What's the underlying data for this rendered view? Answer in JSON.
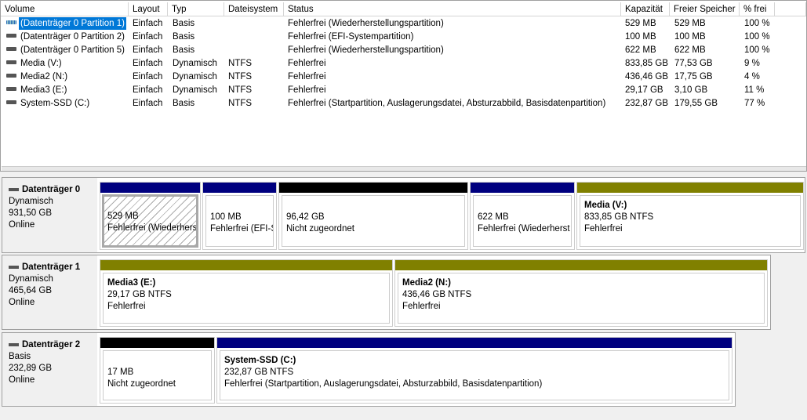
{
  "columns": [
    "Volume",
    "Layout",
    "Typ",
    "Dateisystem",
    "Status",
    "Kapazität",
    "Freier Speicher",
    "% frei"
  ],
  "volumes": [
    [
      "(Datenträger 0 Partition 1)",
      "Einfach",
      "Basis",
      "",
      "Fehlerfrei (Wiederherstellungspartition)",
      "529 MB",
      "529 MB",
      "100 %"
    ],
    [
      "(Datenträger 0 Partition 2)",
      "Einfach",
      "Basis",
      "",
      "Fehlerfrei (EFI-Systempartition)",
      "100 MB",
      "100 MB",
      "100 %"
    ],
    [
      "(Datenträger 0 Partition 5)",
      "Einfach",
      "Basis",
      "",
      "Fehlerfrei (Wiederherstellungspartition)",
      "622 MB",
      "622 MB",
      "100 %"
    ],
    [
      "Media (V:)",
      "Einfach",
      "Dynamisch",
      "NTFS",
      "Fehlerfrei",
      "833,85 GB",
      "77,53 GB",
      "9 %"
    ],
    [
      "Media2 (N:)",
      "Einfach",
      "Dynamisch",
      "NTFS",
      "Fehlerfrei",
      "436,46 GB",
      "17,75 GB",
      "4 %"
    ],
    [
      "Media3 (E:)",
      "Einfach",
      "Dynamisch",
      "NTFS",
      "Fehlerfrei",
      "29,17 GB",
      "3,10 GB",
      "11 %"
    ],
    [
      "System-SSD (C:)",
      "Einfach",
      "Basis",
      "NTFS",
      "Fehlerfrei (Startpartition, Auslagerungsdatei, Absturzabbild, Basisdatenpartition)",
      "232,87 GB",
      "179,55 GB",
      "77 %"
    ]
  ],
  "disks": [
    {
      "name": "Datenträger 0",
      "type": "Dynamisch",
      "size": "931,50 GB",
      "state": "Online",
      "partitions": [
        {
          "title": "",
          "line1": "529 MB",
          "line2": "Fehlerfrei (Wiederhers",
          "color": "#00007f",
          "selected": true
        },
        {
          "title": "",
          "line1": "100 MB",
          "line2": "Fehlerfrei (EFI-S",
          "color": "#00007f"
        },
        {
          "title": "",
          "line1": "96,42 GB",
          "line2": "Nicht zugeordnet",
          "color": "#000000"
        },
        {
          "title": "",
          "line1": "622 MB",
          "line2": "Fehlerfrei (Wiederherst",
          "color": "#00007f"
        },
        {
          "title": "Media  (V:)",
          "line1": "833,85 GB NTFS",
          "line2": "Fehlerfrei",
          "color": "#808000"
        }
      ]
    },
    {
      "name": "Datenträger 1",
      "type": "Dynamisch",
      "size": "465,64 GB",
      "state": "Online",
      "partitions": [
        {
          "title": "Media3  (E:)",
          "line1": "29,17 GB NTFS",
          "line2": "Fehlerfrei",
          "color": "#808000"
        },
        {
          "title": "Media2  (N:)",
          "line1": "436,46 GB NTFS",
          "line2": "Fehlerfrei",
          "color": "#808000"
        }
      ]
    },
    {
      "name": "Datenträger 2",
      "type": "Basis",
      "size": "232,89 GB",
      "state": "Online",
      "partitions": [
        {
          "title": "",
          "line1": "17 MB",
          "line2": "Nicht zugeordnet",
          "color": "#000000"
        },
        {
          "title": "System-SSD  (C:)",
          "line1": "232,87 GB NTFS",
          "line2": "Fehlerfrei (Startpartition, Auslagerungsdatei, Absturzabbild, Basisdatenpartition)",
          "color": "#00007f"
        }
      ]
    }
  ]
}
